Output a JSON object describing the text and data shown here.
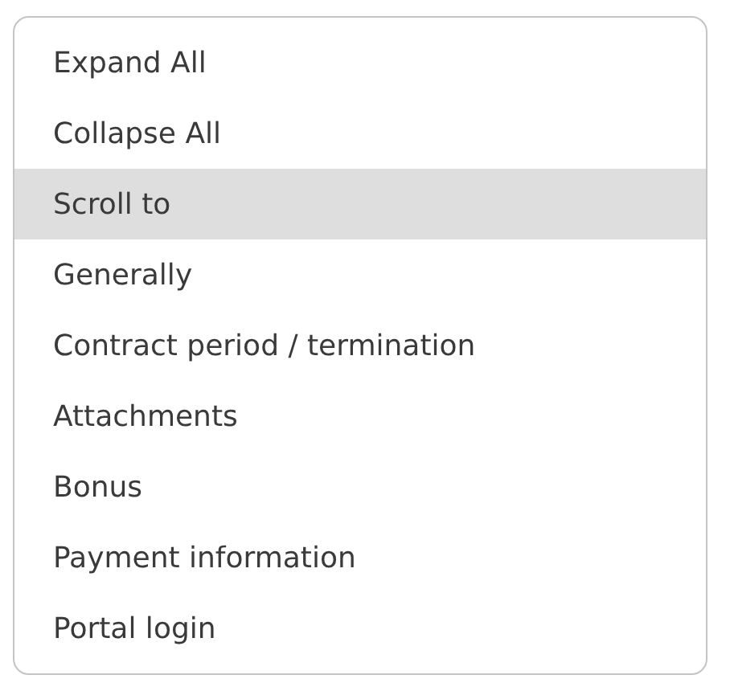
{
  "menu": {
    "items": [
      {
        "label": "Expand All",
        "selected": false
      },
      {
        "label": "Collapse All",
        "selected": false
      },
      {
        "label": "Scroll to",
        "selected": true
      },
      {
        "label": "Generally",
        "selected": false
      },
      {
        "label": "Contract period / termination",
        "selected": false
      },
      {
        "label": "Attachments",
        "selected": false
      },
      {
        "label": "Bonus",
        "selected": false
      },
      {
        "label": "Payment information",
        "selected": false
      },
      {
        "label": "Portal login",
        "selected": false
      }
    ]
  }
}
